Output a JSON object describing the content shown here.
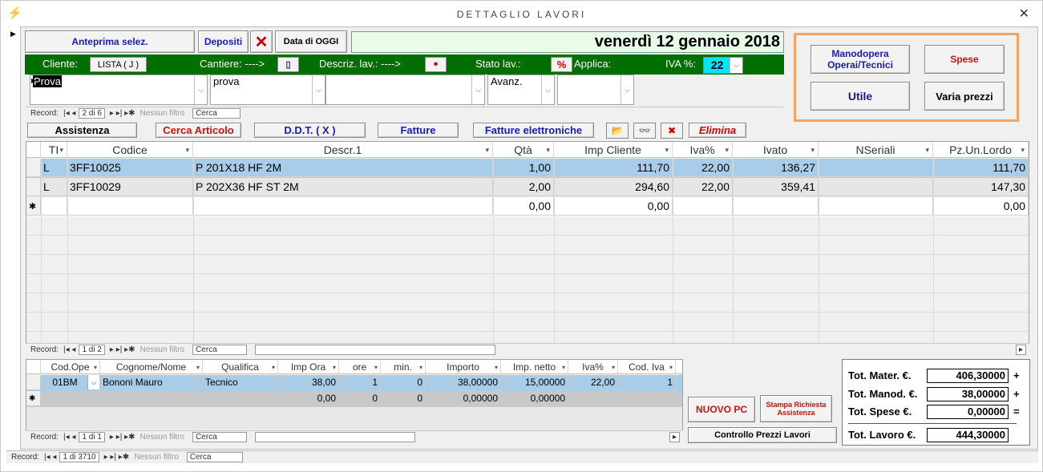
{
  "window": {
    "title": "DETTAGLIO LAVORI",
    "close_glyph": "✕",
    "app_glyph": "⚡"
  },
  "toolbar": {
    "preview_label": "Anteprima selez.",
    "deposits_label": "Depositi",
    "delete_glyph": "✕",
    "today_label": "Data di OGGI",
    "date_display": "venerdì 12 gennaio 2018"
  },
  "header": {
    "cliente_label": "Cliente:",
    "lista_label": "LISTA ( J )",
    "cantiere_label": "Cantiere: ---->",
    "cantiere_btn": "▯",
    "descriz_label": "Descriz. lav.: ---->",
    "descriz_btn": "•",
    "stato_label": "Stato lav.:",
    "stato_btn": "%",
    "applica_label": "Applica:",
    "iva_label": "IVA %:",
    "iva_value": "22",
    "cliente_value": "Prova",
    "cantiere_value": "prova",
    "descriz_value": "",
    "stato_value": "Avanz.",
    "applica_value": ""
  },
  "nav_main_top": {
    "record_label": "Record:",
    "position": "2 di 6",
    "filter": "Nessun filtro",
    "search": "Cerca"
  },
  "right_panel": {
    "manodopera_label": "Manodopera\nOperai/Tecnici",
    "spese_label": "Spese",
    "utile_label": "Utile",
    "varia_label": "Varia prezzi"
  },
  "action_bar": {
    "assistenza": "Assistenza",
    "cerca_articolo": "Cerca Articolo",
    "ddt": "D.D.T. ( X )",
    "fatture": "Fatture",
    "fatture_el": "Fatture elettroniche",
    "elimina": "Elimina"
  },
  "items_grid": {
    "columns": [
      "TI",
      "Codice",
      "Descr.1",
      "Qtà",
      "Imp Cliente",
      "Iva%",
      "Ivato",
      "NSeriali",
      "Pz.Un.Lordo"
    ],
    "rows": [
      [
        "L",
        "3FF10025",
        "P 201X18 HF 2M",
        "1,00",
        "111,70",
        "22,00",
        "136,27",
        "",
        "111,70"
      ],
      [
        "L",
        "3FF10029",
        "P 202X36 HF ST 2M",
        "2,00",
        "294,60",
        "22,00",
        "359,41",
        "",
        "147,30"
      ]
    ],
    "new_row": [
      "",
      "",
      "",
      "0,00",
      "0,00",
      "",
      "",
      "",
      "0,00"
    ],
    "new_marker": "✱"
  },
  "nav_items": {
    "record_label": "Record:",
    "position": "1 di 2",
    "filter": "Nessun filtro",
    "search": "Cerca"
  },
  "labor_grid": {
    "columns": [
      "Cod.Ope",
      "Cognome/Nome",
      "Qualifica",
      "Imp Ora",
      "ore",
      "min.",
      "Importo",
      "Imp. netto",
      "Iva%",
      "Cod. Iva"
    ],
    "rows": [
      [
        "01BM",
        "Bononi Mauro",
        "Tecnico",
        "38,00",
        "1",
        "0",
        "38,00000",
        "15,00000",
        "22,00",
        "1"
      ]
    ],
    "new_row": [
      "",
      "",
      "",
      "0,00",
      "0",
      "0",
      "0,00000",
      "0,00000",
      "",
      ""
    ],
    "new_marker": "✱"
  },
  "nav_labor": {
    "record_label": "Record:",
    "position": "1 di 1",
    "filter": "Nessun filtro",
    "search": "Cerca"
  },
  "bottom_buttons": {
    "nuovo_pc": "NUOVO PC",
    "stampa": "Stampa Richiesta\nAssistenza",
    "controllo": "Controllo Prezzi Lavori"
  },
  "totals": {
    "mater_label": "Tot. Mater.  €.",
    "mater_value": "406,30000",
    "mater_op": "+",
    "manod_label": "Tot. Manod. €.",
    "manod_value": "38,00000",
    "manod_op": "+",
    "spese_label": "Tot. Spese  €.",
    "spese_value": "0,00000",
    "spese_op": "=",
    "lavoro_label": "Tot. Lavoro €.",
    "lavoro_value": "444,30000"
  },
  "nav_outer": {
    "record_label": "Record:",
    "position": "1 di 3710",
    "filter": "Nessun filtro",
    "search": "Cerca"
  },
  "colors": {
    "green": "#006f00",
    "selected_row": "#a8cde8",
    "orange": "#f4a460",
    "date_bg": "#e9fbe9"
  }
}
